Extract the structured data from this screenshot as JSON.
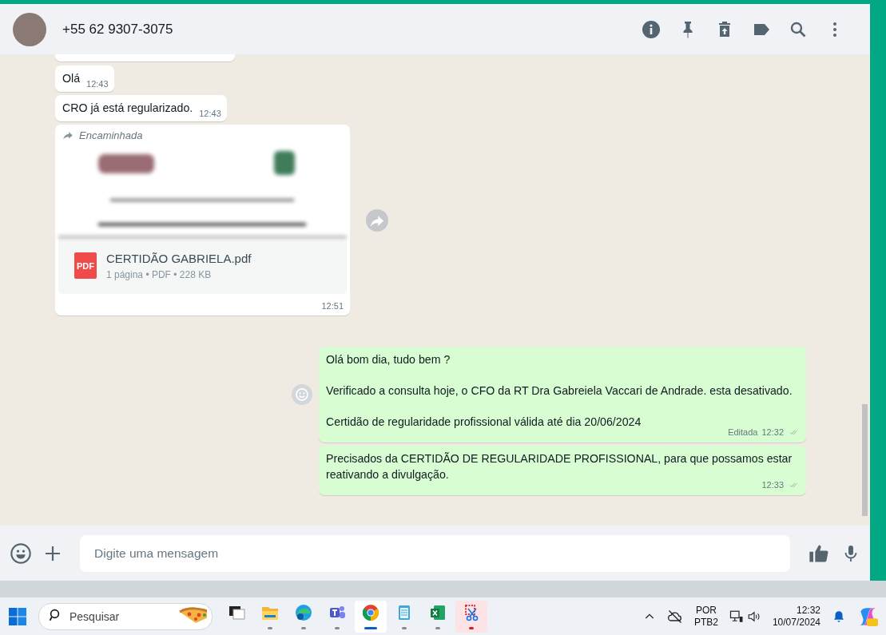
{
  "chat_header": {
    "contact": "+55 62 9307-3075",
    "actions": [
      {
        "kind": "info"
      },
      {
        "kind": "pin"
      },
      {
        "kind": "delete"
      },
      {
        "kind": "label"
      },
      {
        "kind": "search"
      },
      {
        "kind": "menu"
      }
    ]
  },
  "messages": [
    {
      "kind": "stub",
      "outgoing": false
    },
    {
      "kind": "text",
      "outgoing": false,
      "paragraphs": [
        "Olá"
      ],
      "time": "12:43"
    },
    {
      "kind": "text",
      "outgoing": false,
      "paragraphs": [
        "CRO já está regularizado."
      ],
      "time": "12:43"
    },
    {
      "kind": "document",
      "outgoing": false,
      "forwarded_label": "Encaminhada",
      "file_name": "CERTIDÃO GABRIELA.pdf",
      "file_type": "PDF",
      "file_meta": "1 página • PDF • 228 KB",
      "time": "12:51"
    },
    {
      "kind": "text",
      "outgoing": true,
      "paragraphs": [
        "Olá bom dia, tudo bem ?",
        "Verificado a consulta hoje, o CFO da RT Dra Gabreiela Vaccari de Andrade. esta desativado.",
        "Certidão de regularidade profissional válida até dia 20/06/2024"
      ],
      "edited_label": "Editada",
      "time": "12:32",
      "read": false
    },
    {
      "kind": "text",
      "outgoing": true,
      "paragraphs": [
        "Precisados da CERTIDÃO DE REGULARIDADE PROFISSIONAL, para que possamos estar reativando a divulgação."
      ],
      "time": "12:33",
      "read": false
    }
  ],
  "composer": {
    "placeholder": "Digite uma mensagem"
  },
  "taskbar": {
    "search_placeholder": "Pesquisar",
    "apps": [
      {
        "kind": "taskview",
        "running": false,
        "selected": false,
        "attention": false
      },
      {
        "kind": "folder",
        "running": true,
        "selected": false,
        "attention": false
      },
      {
        "kind": "edge",
        "running": true,
        "selected": false,
        "attention": false
      },
      {
        "kind": "teams",
        "running": true,
        "selected": false,
        "attention": false
      },
      {
        "kind": "chrome",
        "running": true,
        "selected": true,
        "attention": false
      },
      {
        "kind": "notepad",
        "running": true,
        "selected": false,
        "attention": false
      },
      {
        "kind": "excel",
        "running": true,
        "selected": false,
        "attention": false
      },
      {
        "kind": "snip",
        "running": true,
        "selected": false,
        "attention": true
      }
    ],
    "language": [
      "POR",
      "PTB2"
    ],
    "time": "12:32",
    "date": "10/07/2024"
  }
}
